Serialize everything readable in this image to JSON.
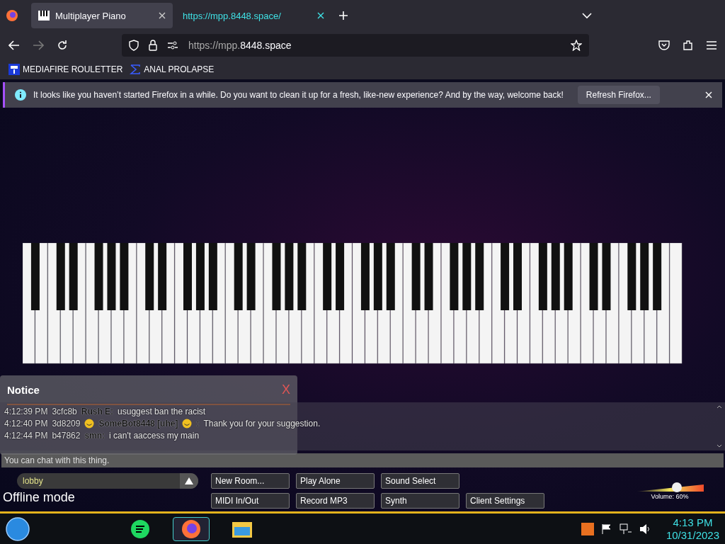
{
  "browser": {
    "tabs": [
      {
        "label": "Multiplayer Piano",
        "selected": true
      },
      {
        "label": "https://mpp.8448.space/",
        "selected": false
      }
    ],
    "url": {
      "prefix": "https://mpp.",
      "domain": "8448.space"
    },
    "bookmarks": [
      {
        "label": "MEDIAFIRE ROULETTER",
        "kind": "mf"
      },
      {
        "label": "ANAL PROLAPSE",
        "kind": "sigma"
      }
    ],
    "notification": {
      "message": "It looks like you haven’t started Firefox in a while. Do you want to clean it up for a fresh, like-new experience? And by the way, welcome back!",
      "button": "Refresh Firefox..."
    }
  },
  "notice": {
    "title": "Notice",
    "close": "X"
  },
  "chat": {
    "messages": [
      {
        "time": "4:12:39 PM",
        "id": "3cfc8b",
        "name": "Rush E:",
        "text": "usuggest ban the racist",
        "decorated": false
      },
      {
        "time": "4:12:40 PM",
        "id": "3d8209",
        "name": "SomeBot8448 [uhe]",
        "name_end": ":",
        "text": "Thank you for your suggestion.",
        "decorated": true
      },
      {
        "time": "4:12:44 PM",
        "id": "b47862",
        "name": "smn:",
        "text": "i can't aaccess my main",
        "decorated": false
      }
    ],
    "placeholder": "You can chat with this thing."
  },
  "room": {
    "value": "lobby",
    "status": "Offline mode"
  },
  "buttons": [
    [
      "New Room...",
      "Play Alone",
      "Sound Select"
    ],
    [
      "MIDI In/Out",
      "Record MP3",
      "Synth",
      "Client Settings"
    ]
  ],
  "volume": {
    "level": 0.6,
    "label": "Volume: 60%"
  },
  "taskbar": {
    "apps": [
      {
        "kind": "spotify",
        "selected": false
      },
      {
        "kind": "firefox",
        "selected": true
      },
      {
        "kind": "explorer",
        "selected": false
      }
    ],
    "time": "4:13 PM",
    "date": "10/31/2023"
  }
}
